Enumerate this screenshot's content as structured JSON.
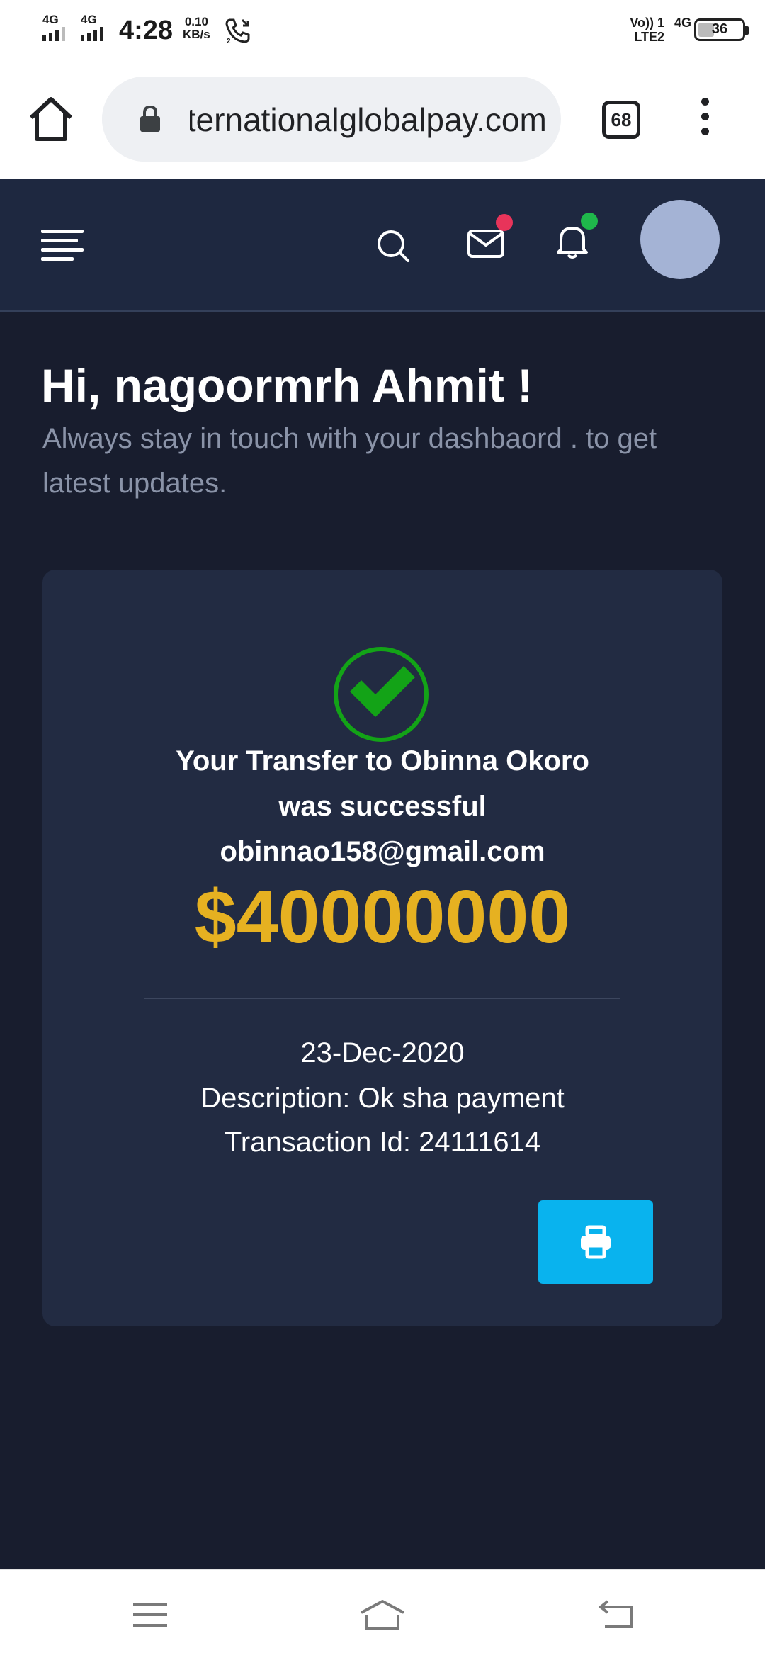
{
  "status_bar": {
    "sim1_network": "4G",
    "sim2_network": "4G",
    "time": "4:28",
    "speed_value": "0.10",
    "speed_unit": "KB/s",
    "call_indicator": "2",
    "volte_line1": "Vo)) 1",
    "volte_line2": "LTE2",
    "network_right": "4G",
    "battery": "36"
  },
  "browser": {
    "url": "internationalglobalpay.com",
    "tab_count": "68"
  },
  "header": {
    "icons": [
      "menu-icon",
      "search-icon",
      "mail-icon",
      "bell-icon",
      "avatar"
    ],
    "mail_badge_color": "#e8345a",
    "bell_badge_color": "#1fb84b"
  },
  "greeting": {
    "title": "Hi, nagoormrh Ahmit !",
    "subtitle": "Always stay in touch with your dashbaord . to get latest updates."
  },
  "transfer": {
    "line1": "Your Transfer to Obinna Okoro",
    "line2": "was successful",
    "email": "obinnao158@gmail.com",
    "amount": "$40000000",
    "date": "23-Dec-2020",
    "description": "Description: Ok sha payment",
    "transaction_id": "Transaction Id: 24111614",
    "print_icon": "print-icon"
  },
  "colors": {
    "background": "#181d2e",
    "header": "#1e2840",
    "card": "#222b42",
    "amount": "#e6b121",
    "success": "#13a317",
    "print_button": "#09b3ee"
  }
}
